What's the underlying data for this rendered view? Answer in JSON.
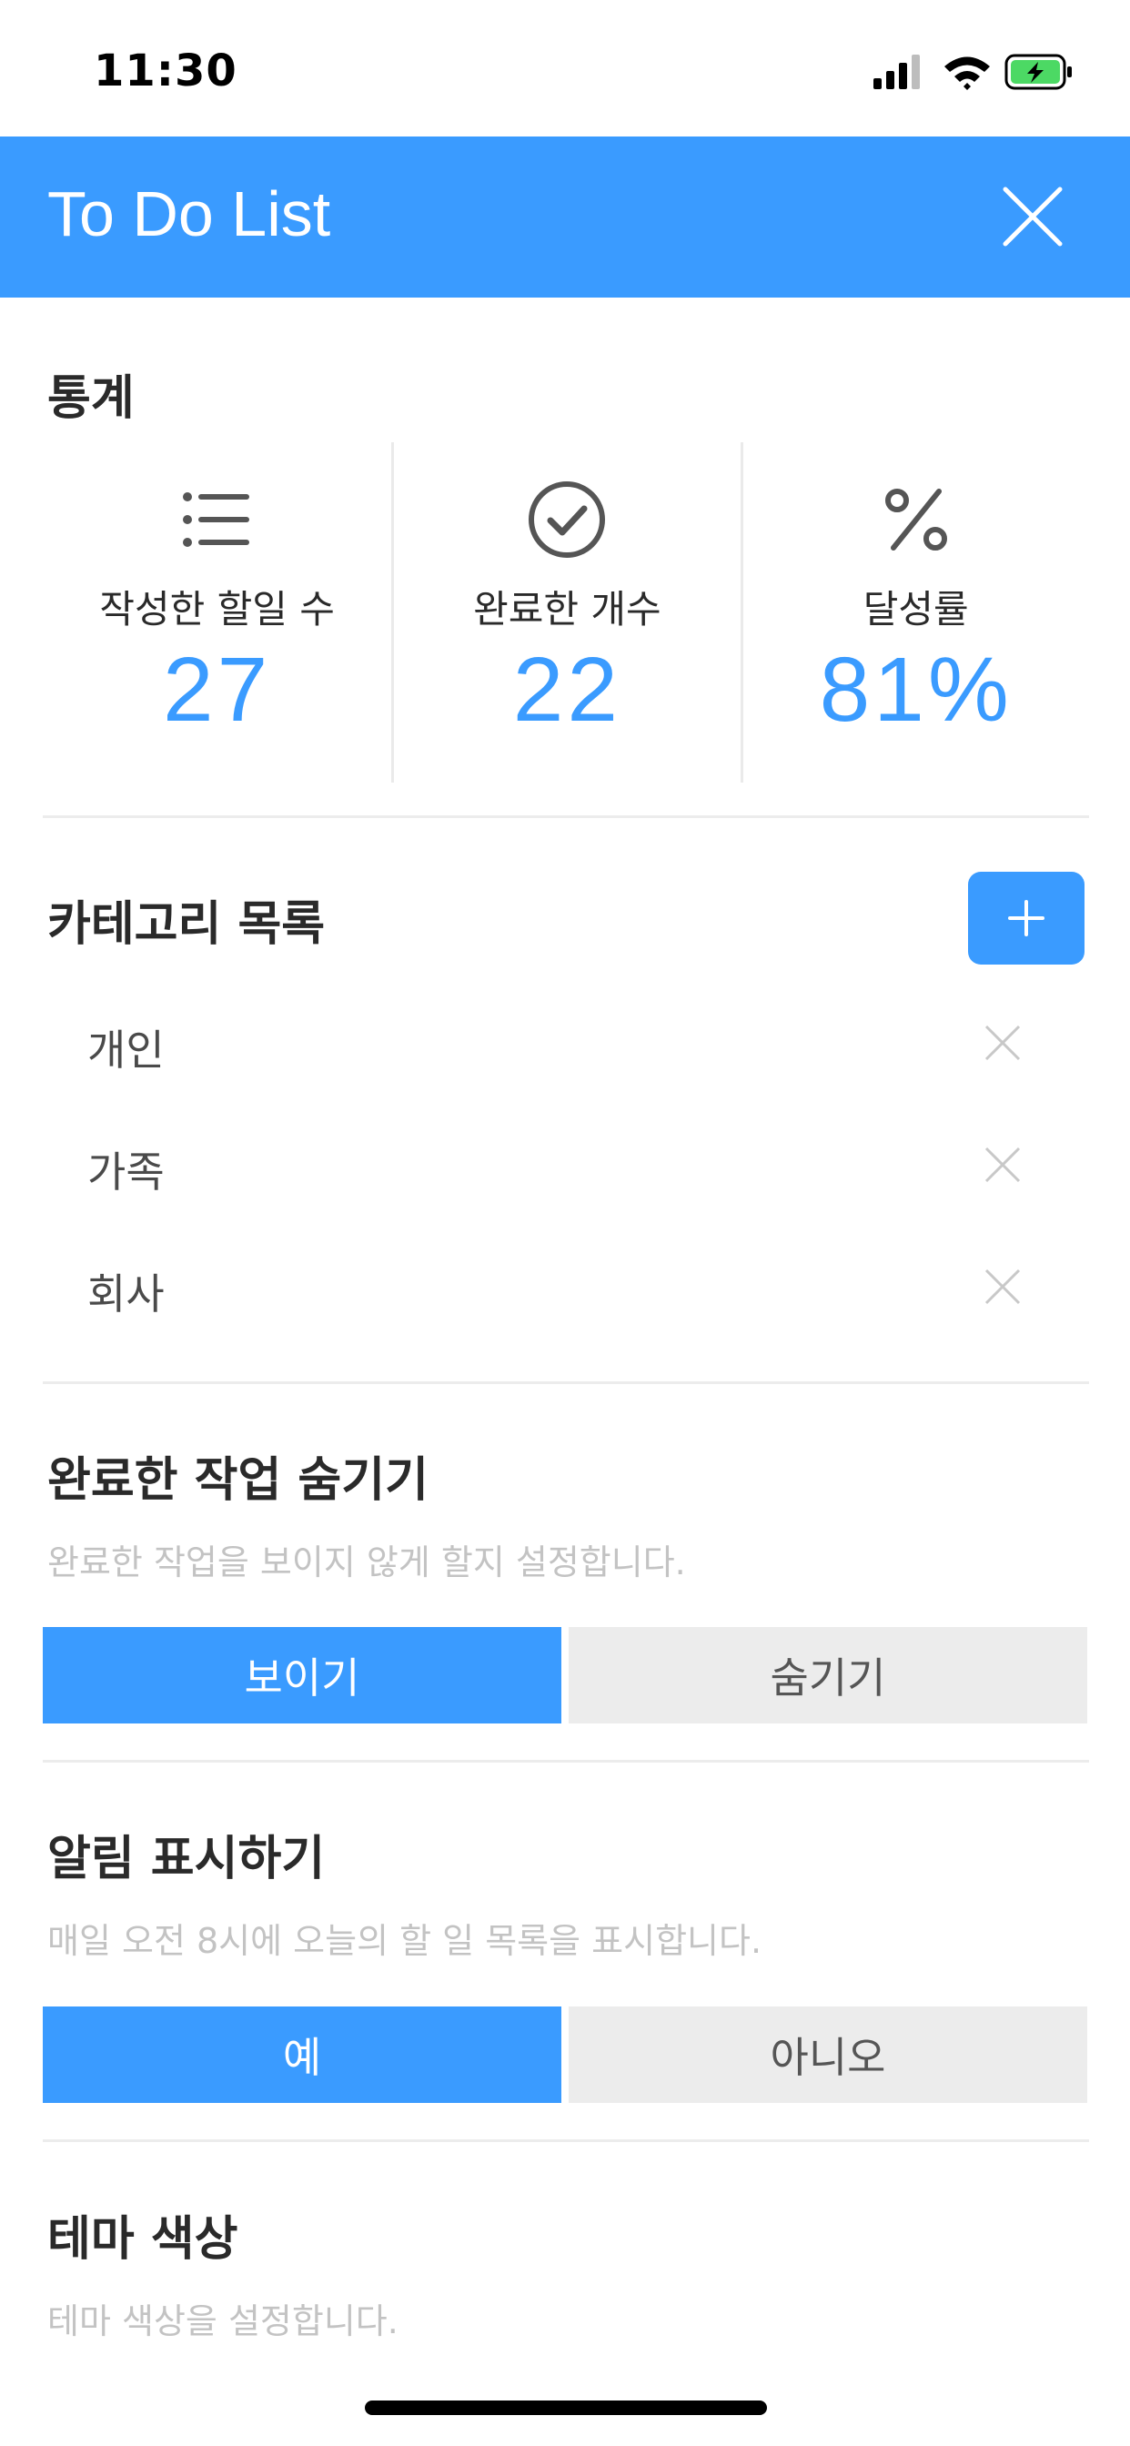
{
  "status_bar": {
    "time": "11:30"
  },
  "header": {
    "title": "To Do List"
  },
  "stats": {
    "title": "통계",
    "items": [
      {
        "label": "작성한 할일 수",
        "value": "27",
        "icon": "list-icon"
      },
      {
        "label": "완료한 개수",
        "value": "22",
        "icon": "check-circle-icon"
      },
      {
        "label": "달성률",
        "value": "81%",
        "icon": "percent-icon"
      }
    ]
  },
  "categories": {
    "title": "카테고리 목록",
    "items": [
      "개인",
      "가족",
      "회사"
    ]
  },
  "hide_completed": {
    "title": "완료한 작업 숨기기",
    "description": "완료한 작업을 보이지 않게 할지 설정합니다.",
    "options": [
      "보이기",
      "숨기기"
    ],
    "selected": "보이기"
  },
  "notifications": {
    "title": "알림 표시하기",
    "description": "매일 오전 8시에 오늘의 할 일 목록을 표시합니다.",
    "options": [
      "예",
      "아니오"
    ],
    "selected": "예"
  },
  "theme": {
    "title": "테마 색상",
    "description": "테마 색상을 설정합니다."
  },
  "colors": {
    "accent": "#3a9bff",
    "battery": "#4cd964"
  }
}
